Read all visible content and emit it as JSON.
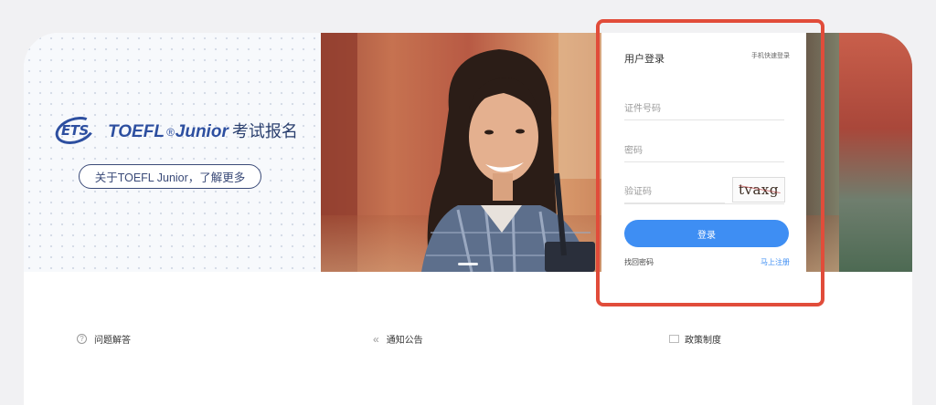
{
  "brand": {
    "ets_logo_text": "ETS",
    "title_en": "TOEFL",
    "title_junior": "Junior",
    "title_cn": "考试报名",
    "about_button": "关于TOEFL Junior，了解更多"
  },
  "login": {
    "title": "用户登录",
    "switch_link": "手机快速登录",
    "id_placeholder": "证件号码",
    "password_placeholder": "密码",
    "captcha_placeholder": "验证码",
    "captcha_text": "tvaxg",
    "login_button": "登录",
    "forgot_password": "找回密码",
    "register": "马上注册"
  },
  "sections": {
    "faq": "问题解答",
    "notice": "通知公告",
    "policy": "政策制度"
  },
  "colors": {
    "accent_blue": "#3e8ef3",
    "brand_navy": "#2d4fa0",
    "highlight_red": "#e14c3a"
  },
  "icons": {
    "faq": "question-circle-icon",
    "notice": "double-chevron-left-icon",
    "policy": "document-icon"
  }
}
